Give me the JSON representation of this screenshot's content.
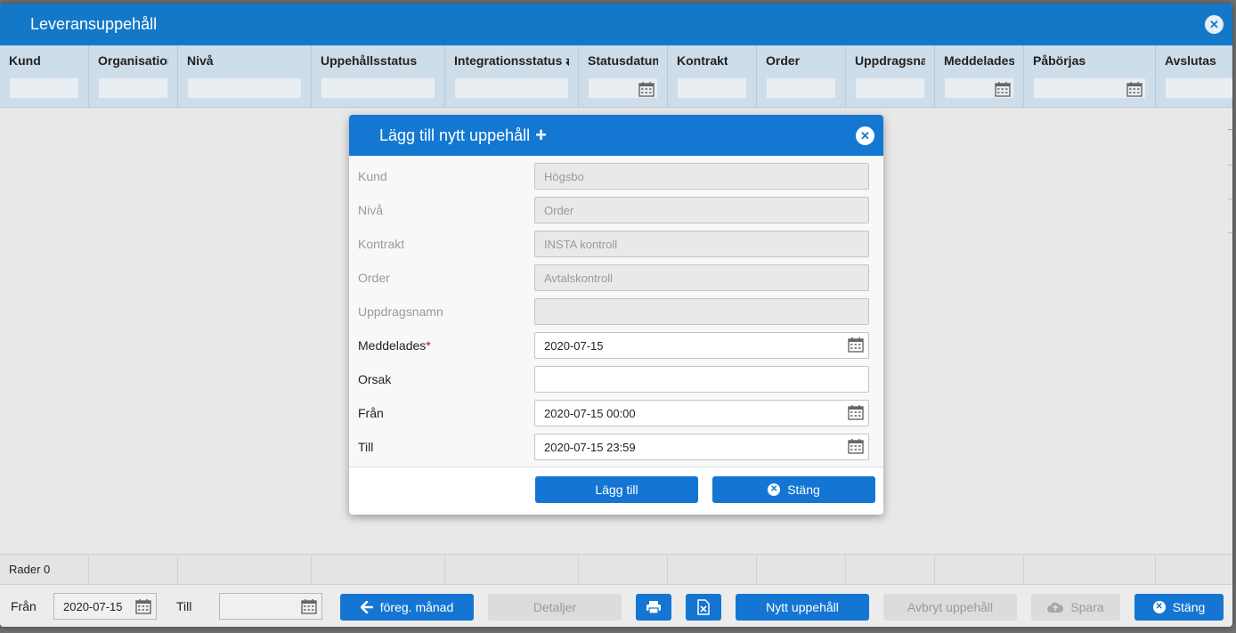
{
  "window": {
    "title": "Leveransuppehåll"
  },
  "filters": [
    {
      "label": "Kund",
      "has_calendar": false
    },
    {
      "label": "Organisation",
      "has_calendar": false
    },
    {
      "label": "Nivå",
      "has_calendar": false
    },
    {
      "label": "Uppehållsstatus",
      "has_calendar": false
    },
    {
      "label": "Integrationsstatus ⇄",
      "has_calendar": false
    },
    {
      "label": "Statusdatum",
      "has_calendar": true
    },
    {
      "label": "Kontrakt",
      "has_calendar": false
    },
    {
      "label": "Order",
      "has_calendar": false
    },
    {
      "label": "Uppdragsnamn",
      "has_calendar": false
    },
    {
      "label": "Meddelades",
      "has_calendar": true
    },
    {
      "label": "Påbörjas",
      "has_calendar": true
    },
    {
      "label": "Avslutas",
      "has_calendar": false
    }
  ],
  "footer": {
    "row_count": "Rader 0"
  },
  "bottom": {
    "from_label": "Från",
    "from_value": "2020-07-15",
    "to_label": "Till",
    "to_value": "",
    "prev_month": "föreg. månad",
    "details": "Detaljer",
    "new_pause": "Nytt uppehåll",
    "cancel_pause": "Avbryt uppehåll",
    "save": "Spara",
    "close": "Stäng"
  },
  "modal": {
    "title": "Lägg till nytt uppehåll",
    "fields": {
      "kund": {
        "label": "Kund",
        "value": "Högsbo"
      },
      "niva": {
        "label": "Nivå",
        "value": "Order"
      },
      "kontrakt": {
        "label": "Kontrakt",
        "value": "INSTA kontroll"
      },
      "order": {
        "label": "Order",
        "value": "Avtalskontroll"
      },
      "uppdragsnamn": {
        "label": "Uppdragsnamn",
        "value": ""
      },
      "meddelades": {
        "label": "Meddelades",
        "required_mark": "*",
        "value": "2020-07-15"
      },
      "orsak": {
        "label": "Orsak",
        "value": ""
      },
      "fran": {
        "label": "Från",
        "value": "2020-07-15 00:00"
      },
      "till": {
        "label": "Till",
        "value": "2020-07-15 23:59"
      }
    },
    "add_label": "Lägg till",
    "close_label": "Stäng"
  },
  "colors": {
    "header_blue": "#1478c8",
    "button_blue": "#1476d2",
    "filter_bg": "#cddde9"
  }
}
